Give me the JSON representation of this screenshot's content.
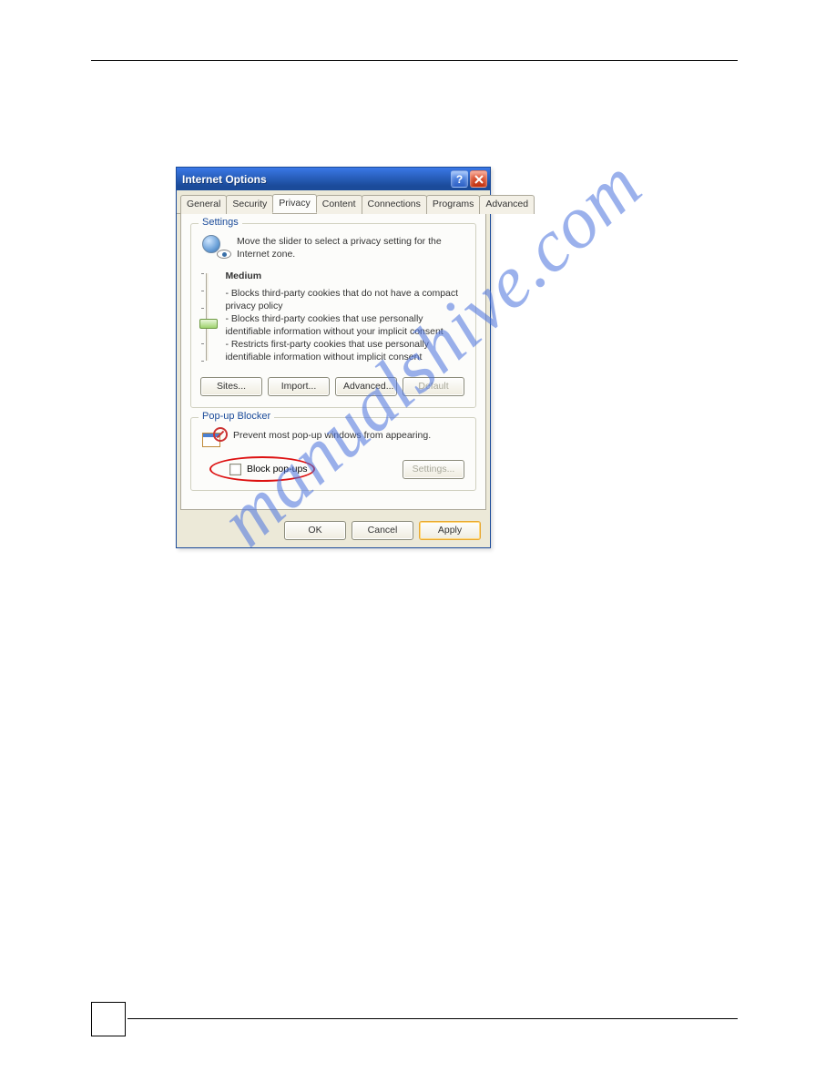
{
  "dialog": {
    "title": "Internet Options",
    "tabs": [
      "General",
      "Security",
      "Privacy",
      "Content",
      "Connections",
      "Programs",
      "Advanced"
    ],
    "active_tab_index": 2
  },
  "settings_group": {
    "title": "Settings",
    "intro": "Move the slider to select a privacy setting for the Internet zone.",
    "level": "Medium",
    "bullets": [
      "- Blocks third-party cookies that do not have a compact privacy policy",
      "- Blocks third-party cookies that use personally identifiable information without your implicit consent",
      "- Restricts first-party cookies that use personally identifiable information without implicit consent"
    ],
    "buttons": {
      "sites": "Sites...",
      "import": "Import...",
      "advanced": "Advanced...",
      "default": "Default"
    }
  },
  "popup_group": {
    "title": "Pop-up Blocker",
    "intro": "Prevent most pop-up windows from appearing.",
    "checkbox_label": "Block pop-ups",
    "checked": false,
    "settings_button": "Settings..."
  },
  "footer": {
    "ok": "OK",
    "cancel": "Cancel",
    "apply": "Apply"
  },
  "watermark": "manualshive.com"
}
